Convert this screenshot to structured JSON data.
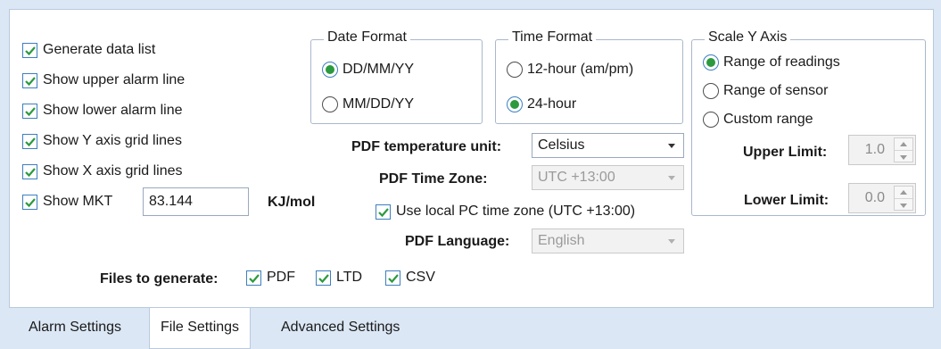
{
  "checkboxes": {
    "generate_data_list": "Generate data list",
    "show_upper_alarm": "Show upper alarm line",
    "show_lower_alarm": "Show lower alarm line",
    "show_y_grid": "Show Y axis grid lines",
    "show_x_grid": "Show X axis grid lines",
    "show_mkt": "Show MKT"
  },
  "mkt": {
    "value": "83.144",
    "unit": "KJ/mol"
  },
  "date_format": {
    "legend": "Date Format",
    "options": [
      "DD/MM/YY",
      "MM/DD/YY"
    ],
    "selected": "DD/MM/YY"
  },
  "time_format": {
    "legend": "Time Format",
    "options": [
      "12-hour (am/pm)",
      "24-hour"
    ],
    "selected": "24-hour"
  },
  "scale_y": {
    "legend": "Scale Y Axis",
    "options": [
      "Range of readings",
      "Range of sensor",
      "Custom range"
    ],
    "selected": "Range of readings",
    "upper_label": "Upper Limit:",
    "upper_value": "1.0",
    "lower_label": "Lower Limit:",
    "lower_value": "0.0"
  },
  "pdf": {
    "temp_unit_label": "PDF temperature unit:",
    "temp_unit_value": "Celsius",
    "timezone_label": "PDF Time Zone:",
    "timezone_value": "UTC +13:00",
    "use_local_tz": "Use local PC time zone (UTC +13:00)",
    "language_label": "PDF Language:",
    "language_value": "English"
  },
  "files": {
    "label": "Files to generate:",
    "pdf": "PDF",
    "ltd": "LTD",
    "csv": "CSV"
  },
  "tabs": [
    "Alarm Settings",
    "File Settings",
    "Advanced Settings"
  ],
  "colors": {
    "check": "#2b9a3e",
    "accent_border": "#3d7fbf",
    "background": "#dbe7f5"
  },
  "icons": {
    "checkmark": "check-icon",
    "dropdown": "chevron-down-icon",
    "spin_up": "chevron-up-icon",
    "spin_down": "chevron-down-icon"
  }
}
